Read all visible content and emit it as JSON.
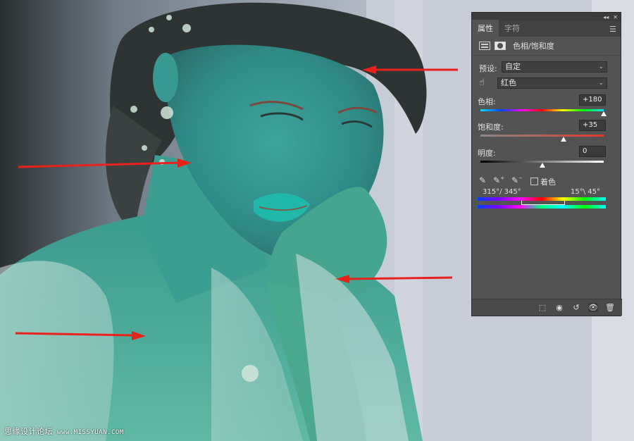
{
  "panel": {
    "tabs": [
      "属性",
      "字符"
    ],
    "header_title": "色相/饱和度",
    "preset_label": "预设:",
    "preset_value": "自定",
    "channel_value": "红色",
    "hue_label": "色相:",
    "hue_value": "+180",
    "hue_level": 1.0,
    "saturation_label": "饱和度:",
    "saturation_value": "+35",
    "saturation_level": 0.675,
    "lightness_label": "明度:",
    "lightness_value": "0",
    "lightness_level": 0.5,
    "colorize_label": "着色",
    "range_left": "315°/ 345°",
    "range_right": "15°\\ 45°"
  },
  "watermark": {
    "text": "思缘设计论坛",
    "url": "www.MISSYUAN.COM"
  },
  "colors": {
    "panel_bg": "#535353",
    "arrow": "#e8221b"
  },
  "icons": [
    "panel-collapse-icon",
    "panel-close-icon",
    "panel-menu-icon",
    "adjustment-grid-icon",
    "mask-icon",
    "chevron-down-icon",
    "targeted-adjust-hand-icon",
    "eyedropper-icon",
    "eyedropper-plus-icon",
    "eyedropper-minus-icon",
    "clip-to-layer-icon",
    "view-previous-icon",
    "reset-icon",
    "visibility-eye-icon",
    "trash-icon"
  ]
}
